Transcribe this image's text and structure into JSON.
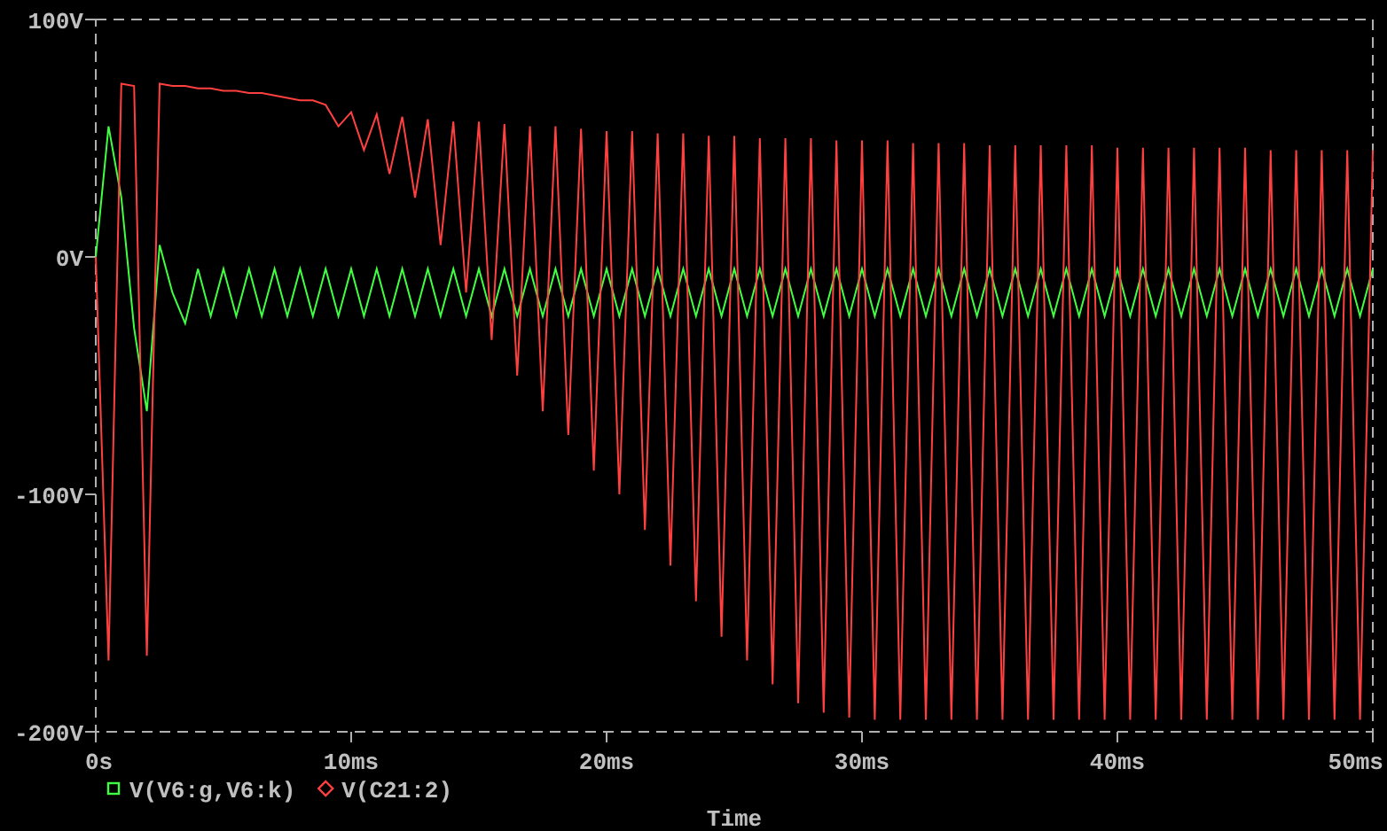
{
  "chart_data": {
    "type": "line",
    "legend": "bottom-left",
    "xlabel": "Time",
    "xlim": [
      0,
      50
    ],
    "ylim": [
      -200,
      100
    ],
    "xticks": [
      {
        "value": 0,
        "label": "0s"
      },
      {
        "value": 10,
        "label": "10ms"
      },
      {
        "value": 20,
        "label": "20ms"
      },
      {
        "value": 30,
        "label": "30ms"
      },
      {
        "value": 40,
        "label": "40ms"
      },
      {
        "value": 50,
        "label": "50ms"
      }
    ],
    "yticks": [
      {
        "value": 100,
        "label": "100V"
      },
      {
        "value": 0,
        "label": "0V"
      },
      {
        "value": -100,
        "label": "-100V"
      },
      {
        "value": -200,
        "label": "-200V"
      }
    ],
    "x": [
      0,
      0.5,
      1,
      1.5,
      2,
      2.5,
      3,
      3.5,
      4,
      4.5,
      5,
      5.5,
      6,
      6.5,
      7,
      7.5,
      8,
      8.5,
      9,
      9.5,
      10,
      10.5,
      11,
      11.5,
      12,
      12.5,
      13,
      13.5,
      14,
      14.5,
      15,
      15.5,
      16,
      16.5,
      17,
      17.5,
      18,
      18.5,
      19,
      19.5,
      20,
      20.5,
      21,
      21.5,
      22,
      22.5,
      23,
      23.5,
      24,
      24.5,
      25,
      25.5,
      26,
      26.5,
      27,
      27.5,
      28,
      28.5,
      29,
      29.5,
      30,
      30.5,
      31,
      31.5,
      32,
      32.5,
      33,
      33.5,
      34,
      34.5,
      35,
      35.5,
      36,
      36.5,
      37,
      37.5,
      38,
      38.5,
      39,
      39.5,
      40,
      40.5,
      41,
      41.5,
      42,
      42.5,
      43,
      43.5,
      44,
      44.5,
      45,
      45.5,
      46,
      46.5,
      47,
      47.5,
      48,
      48.5,
      49,
      49.5,
      50
    ],
    "series": [
      {
        "name": "V(V6:g,V6:k)",
        "color": "#40ff40",
        "values": [
          0,
          55,
          25,
          -30,
          -65,
          5,
          -15,
          -28,
          -5,
          -25,
          -5,
          -25,
          -5,
          -25,
          -5,
          -25,
          -5,
          -25,
          -5,
          -25,
          -5,
          -25,
          -5,
          -25,
          -5,
          -25,
          -5,
          -25,
          -5,
          -25,
          -5,
          -25,
          -5,
          -25,
          -5,
          -25,
          -5,
          -25,
          -5,
          -25,
          -5,
          -25,
          -5,
          -25,
          -5,
          -25,
          -5,
          -25,
          -5,
          -25,
          -5,
          -25,
          -5,
          -25,
          -5,
          -25,
          -5,
          -25,
          -5,
          -25,
          -5,
          -25,
          -5,
          -25,
          -5,
          -25,
          -5,
          -25,
          -5,
          -25,
          -5,
          -25,
          -5,
          -25,
          -5,
          -25,
          -5,
          -25,
          -5,
          -25,
          -5,
          -25,
          -5,
          -25,
          -5,
          -25,
          -5,
          -25,
          -5,
          -25,
          -5,
          -25,
          -5,
          -25,
          -5,
          -25,
          -5,
          -25,
          -5,
          -25,
          -5
        ]
      },
      {
        "name": "V(C21:2)",
        "color": "#ff4040",
        "values": [
          0,
          -170,
          73,
          72,
          -168,
          73,
          72,
          72,
          71,
          71,
          70,
          70,
          69,
          69,
          68,
          67,
          66,
          66,
          64,
          55,
          61,
          45,
          60,
          35,
          59,
          25,
          58,
          5,
          57,
          -15,
          57,
          -35,
          56,
          -50,
          55,
          -65,
          55,
          -75,
          54,
          -90,
          53,
          -100,
          53,
          -115,
          52,
          -130,
          52,
          -145,
          51,
          -160,
          51,
          -170,
          50,
          -180,
          50,
          -188,
          50,
          -192,
          49,
          -194,
          49,
          -195,
          49,
          -195,
          48,
          -195,
          48,
          -195,
          48,
          -195,
          47,
          -195,
          47,
          -195,
          47,
          -195,
          47,
          -195,
          47,
          -195,
          46,
          -195,
          46,
          -195,
          46,
          -195,
          46,
          -195,
          46,
          -195,
          46,
          -195,
          45,
          -195,
          45,
          -195,
          45,
          -195,
          45,
          -195,
          45
        ]
      }
    ]
  }
}
